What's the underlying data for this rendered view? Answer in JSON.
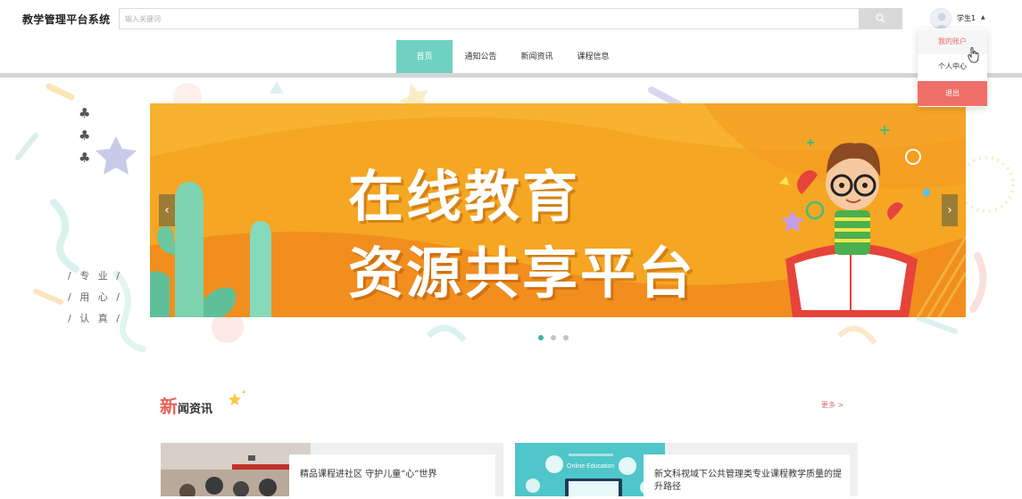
{
  "header": {
    "app_title": "教学管理平台系统",
    "search_placeholder": "输入关键词",
    "user_name": "学生1",
    "caret": "▲"
  },
  "user_menu": {
    "items": [
      {
        "label": "我的账户",
        "state": "hover"
      },
      {
        "label": "个人中心"
      },
      {
        "label": "退出",
        "style": "danger"
      }
    ]
  },
  "nav": {
    "tabs": [
      {
        "label": "首页",
        "active": true,
        "color": "#36b7a3"
      },
      {
        "label": "通知公告",
        "color": "#ee7068"
      },
      {
        "label": "新闻资讯",
        "color": "#f7ca5a"
      },
      {
        "label": "课程信息",
        "color": "#3c9ad8"
      }
    ]
  },
  "side_deco": {
    "clubs": [
      "♣",
      "♣",
      "♣"
    ],
    "slogan": [
      "/ 专 业 /",
      "/ 用 心 /",
      "/ 认 真 /"
    ]
  },
  "banner": {
    "line_1": "在线教育",
    "line_2": "资源共享平台",
    "prev_arrow": "‹",
    "next_arrow": "›",
    "slide_count": 3,
    "active_slide": 1,
    "colors": {
      "primary": "#f5a623",
      "accent": "#f07a1a"
    }
  },
  "news_section": {
    "title_big": "新",
    "title_rest": "闻资讯",
    "more_label": "更多 >",
    "items": [
      {
        "title": "精品课程进社区 守护儿童“心”世界",
        "thumb_icon": "classroom-photo"
      },
      {
        "title": "新文科视域下公共管理类专业课程教学质量的提升路径",
        "thumb_icon": "online-education-illustration",
        "thumb_caption": "Online Education"
      }
    ]
  }
}
